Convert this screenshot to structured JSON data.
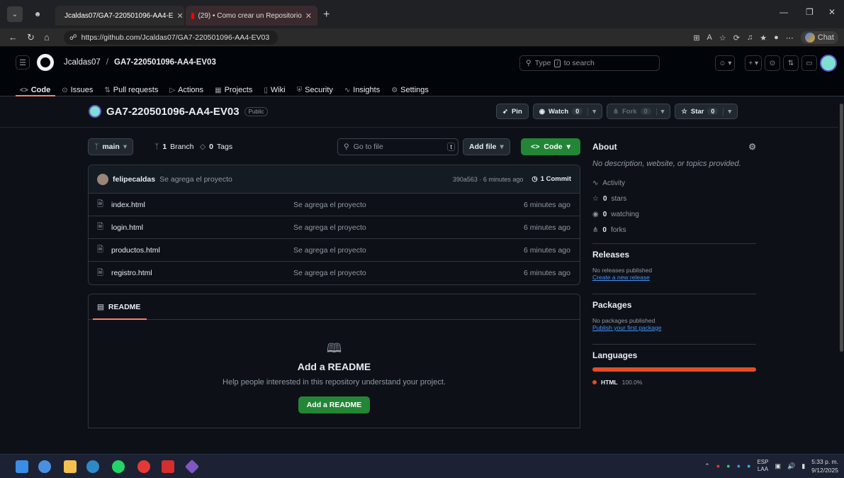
{
  "browser": {
    "tabs": [
      {
        "title": "Jcaldas07/GA7-220501096-AA4-E",
        "active": true
      },
      {
        "title": "(29) • Como crear un Repositorio",
        "active": false
      }
    ],
    "url": "https://github.com/Jcaldas07/GA7-220501096-AA4-EV03",
    "chat_label": "Chat"
  },
  "header": {
    "owner": "Jcaldas07",
    "separator": "/",
    "repo": "GA7-220501096-AA4-EV03",
    "search_prefix": "Type",
    "search_key": "/",
    "search_suffix": "to search"
  },
  "repo_nav": [
    {
      "label": "Code",
      "icon": "<>",
      "active": true
    },
    {
      "label": "Issues",
      "icon": "⊙"
    },
    {
      "label": "Pull requests",
      "icon": "⇅"
    },
    {
      "label": "Actions",
      "icon": "▷"
    },
    {
      "label": "Projects",
      "icon": "▦"
    },
    {
      "label": "Wiki",
      "icon": "▯"
    },
    {
      "label": "Security",
      "icon": "⛨"
    },
    {
      "label": "Insights",
      "icon": "∿"
    },
    {
      "label": "Settings",
      "icon": "⚙"
    }
  ],
  "repo": {
    "title": "GA7-220501096-AA4-EV03",
    "visibility": "Public",
    "pin": "Pin",
    "watch": "Watch",
    "watch_count": "0",
    "fork": "Fork",
    "fork_count": "0",
    "star": "Star",
    "star_count": "0"
  },
  "toolbar": {
    "branch": "main",
    "branches_count": "1",
    "branches_label": "Branch",
    "tags_count": "0",
    "tags_label": "Tags",
    "goto_placeholder": "Go to file",
    "goto_key": "t",
    "add_file": "Add file",
    "code": "Code"
  },
  "commit": {
    "user": "felipecaldas",
    "message": "Se agrega el proyecto",
    "hash_time": "390a563 · 6 minutes ago",
    "count": "1 Commit"
  },
  "files": [
    {
      "name": "index.html",
      "message": "Se agrega el proyecto",
      "time": "6 minutes ago"
    },
    {
      "name": "login.html",
      "message": "Se agrega el proyecto",
      "time": "6 minutes ago"
    },
    {
      "name": "productos.html",
      "message": "Se agrega el proyecto",
      "time": "6 minutes ago"
    },
    {
      "name": "registro.html",
      "message": "Se agrega el proyecto",
      "time": "6 minutes ago"
    }
  ],
  "readme": {
    "tab": "README",
    "title": "Add a README",
    "subtitle": "Help people interested in this repository understand your project.",
    "button": "Add a README"
  },
  "about": {
    "title": "About",
    "description": "No description, website, or topics provided.",
    "activity": "Activity",
    "stars_count": "0",
    "stars_label": "stars",
    "watching_count": "0",
    "watching_label": "watching",
    "forks_count": "0",
    "forks_label": "forks"
  },
  "releases": {
    "title": "Releases",
    "none": "No releases published",
    "link": "Create a new release"
  },
  "packages": {
    "title": "Packages",
    "none": "No packages published",
    "link": "Publish your first package"
  },
  "languages": {
    "title": "Languages",
    "name": "HTML",
    "percent": "100.0%",
    "color": "#e34c26"
  },
  "taskbar": {
    "lang_top": "ESP",
    "lang_bottom": "LAA",
    "time": "5:33 p. m.",
    "date": "9/12/2025"
  }
}
